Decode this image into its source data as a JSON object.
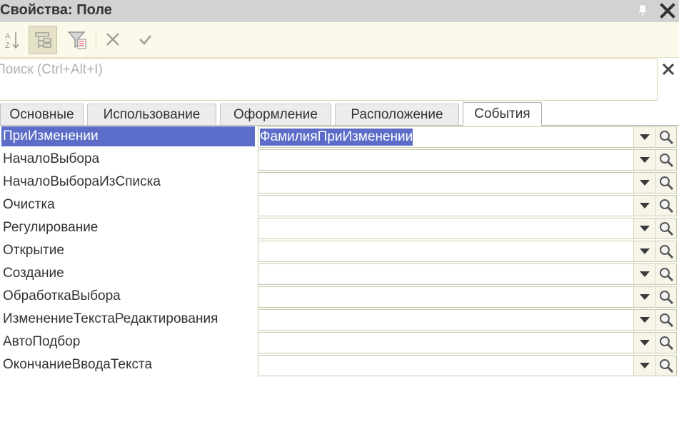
{
  "window": {
    "title": "Свойства: Поле",
    "pin_icon": "pin-icon",
    "close_icon": "close-icon"
  },
  "toolbar": {
    "buttons": [
      {
        "name": "sort-alphabetical-button",
        "icon": "sort-az-icon",
        "pressed": false
      },
      {
        "name": "categories-button",
        "icon": "categories-icon",
        "pressed": true
      },
      {
        "name": "filter-button",
        "icon": "filter-icon",
        "pressed": false
      },
      {
        "name": "clear-button",
        "icon": "x-icon",
        "pressed": false
      },
      {
        "name": "apply-button",
        "icon": "checkmark-icon",
        "pressed": false
      }
    ]
  },
  "search": {
    "placeholder": "Поиск (Ctrl+Alt+I)",
    "value": "",
    "clear_icon": "close-icon"
  },
  "tabs": [
    {
      "label": "Основные",
      "active": false
    },
    {
      "label": "Использование",
      "active": false
    },
    {
      "label": "Оформление",
      "active": false
    },
    {
      "label": "Расположение",
      "active": false
    },
    {
      "label": "События",
      "active": true
    }
  ],
  "events": [
    {
      "label": "ПриИзменении",
      "value": "ФамилияПриИзменении",
      "selected": true
    },
    {
      "label": "НачалоВыбора",
      "value": "",
      "selected": false
    },
    {
      "label": "НачалоВыбораИзСписка",
      "value": "",
      "selected": false
    },
    {
      "label": "Очистка",
      "value": "",
      "selected": false
    },
    {
      "label": "Регулирование",
      "value": "",
      "selected": false
    },
    {
      "label": "Открытие",
      "value": "",
      "selected": false
    },
    {
      "label": "Создание",
      "value": "",
      "selected": false
    },
    {
      "label": "ОбработкаВыбора",
      "value": "",
      "selected": false
    },
    {
      "label": "ИзменениеТекстаРедактирования",
      "value": "",
      "selected": false
    },
    {
      "label": "АвтоПодбор",
      "value": "",
      "selected": false
    },
    {
      "label": "ОкончаниеВводаТекста",
      "value": "",
      "selected": false
    }
  ],
  "colors": {
    "selection": "#5b6dc8",
    "toolbar_bg": "#fbf9e9",
    "titlebar_bg": "#d2d2d2"
  }
}
